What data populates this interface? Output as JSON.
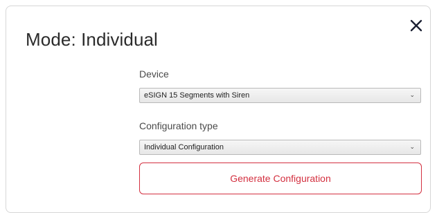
{
  "modal": {
    "title": "Mode: Individual",
    "close_icon": "close-icon"
  },
  "device": {
    "label": "Device",
    "selected": "eSIGN 15 Segments with Siren"
  },
  "config_type": {
    "label": "Configuration type",
    "selected": "Individual Configuration"
  },
  "generate_button": {
    "label": "Generate Configuration",
    "color": "#d32f3f"
  }
}
